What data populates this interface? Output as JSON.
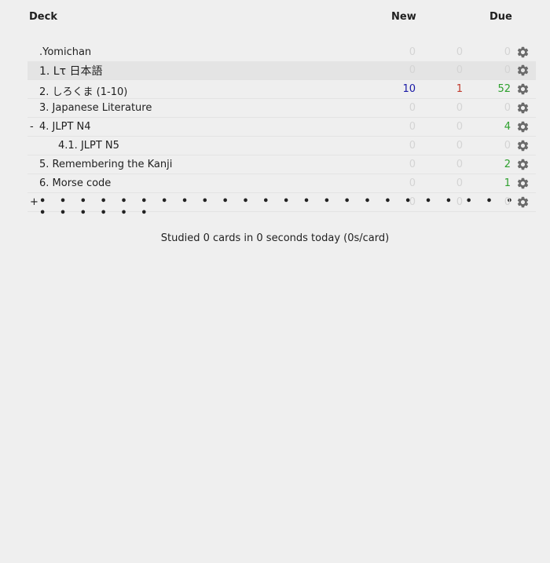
{
  "header": {
    "deck_label": "Deck",
    "new_label": "New",
    "due_label": "Due"
  },
  "decks": [
    {
      "collapse": "",
      "name": ".Yomichan",
      "new": "0",
      "learn": "0",
      "due": "0"
    },
    {
      "collapse": "",
      "name": "1. Lτ 日本語",
      "new": "0",
      "learn": "0",
      "due": "0"
    },
    {
      "collapse": "",
      "name": "2. しろくま (1-10)",
      "new": "10",
      "learn": "1",
      "due": "52"
    },
    {
      "collapse": "",
      "name": "3. Japanese Literature",
      "new": "0",
      "learn": "0",
      "due": "0"
    },
    {
      "collapse": "-",
      "name": "4. JLPT N4",
      "new": "0",
      "learn": "0",
      "due": "4"
    },
    {
      "collapse": "",
      "name": "4.1. JLPT N5",
      "new": "0",
      "learn": "0",
      "due": "0"
    },
    {
      "collapse": "",
      "name": "5. Remembering the Kanji",
      "new": "0",
      "learn": "0",
      "due": "2"
    },
    {
      "collapse": "",
      "name": "6. Morse code",
      "new": "0",
      "learn": "0",
      "due": "1"
    },
    {
      "collapse": "+",
      "name": "• • • • • • • • • • • • • • • • • • • • • • • • • • • • • •",
      "new": "0",
      "learn": "0",
      "due": "0"
    }
  ],
  "stats": {
    "text": "Studied 0 cards in 0 seconds today (0s/card)"
  },
  "colors": {
    "new": "#1a1aa6",
    "learn": "#c0392b",
    "due": "#2ea02e",
    "zero": "#d4d4d4",
    "background": "#efefef"
  },
  "icons": {
    "options": "gear-icon"
  }
}
